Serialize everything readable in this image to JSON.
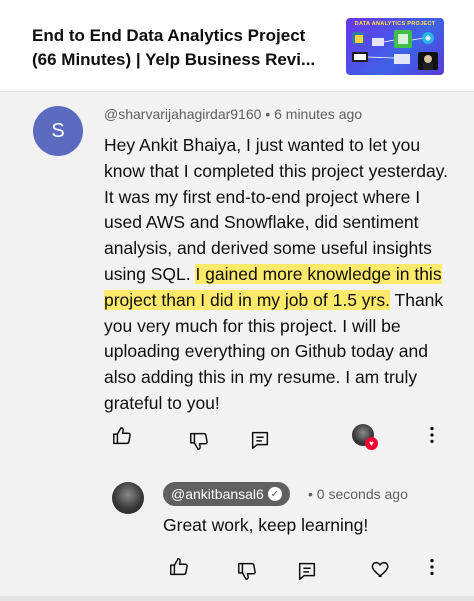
{
  "video": {
    "title_line1": "End to End Data Analytics Project",
    "title_line2": "(66 Minutes) | Yelp Business Revi...",
    "thumbnail_text": "DATA ANALYTICS PROJECT"
  },
  "comment": {
    "avatar_letter": "S",
    "author": "@sharvarijahagirdar9160",
    "separator": "•",
    "time": "6 minutes ago",
    "text_before": "Hey Ankit Bhaiya, I just wanted to let you know that I completed this project yesterday. It was my first end-to-end project where I used AWS and Snowflake, did sentiment analysis, and derived some useful insights using SQL. ",
    "text_highlight": "I gained more knowledge in this project than I did in my job of 1.5 yrs.",
    "text_after": " Thank you very much for this project. I will be uploading everything on Github today and also adding this in my resume. I am truly grateful to you!",
    "highlight_color": "#fde96a"
  },
  "reply": {
    "author": "@ankitbansal6",
    "separator": "•",
    "time": "0 seconds ago",
    "text": "Great work, keep learning!"
  },
  "icons": {
    "like": "thumbs-up-icon",
    "dislike": "thumbs-down-icon",
    "reply": "reply-comment-icon",
    "more": "more-vertical-icon",
    "heart": "heart-icon",
    "verified": "verified-check-icon"
  },
  "colors": {
    "card_background": "#f2f2f2",
    "avatar_bg": "#5c6bc0",
    "heart": "#ff0033",
    "chip_bg": "#606060"
  }
}
